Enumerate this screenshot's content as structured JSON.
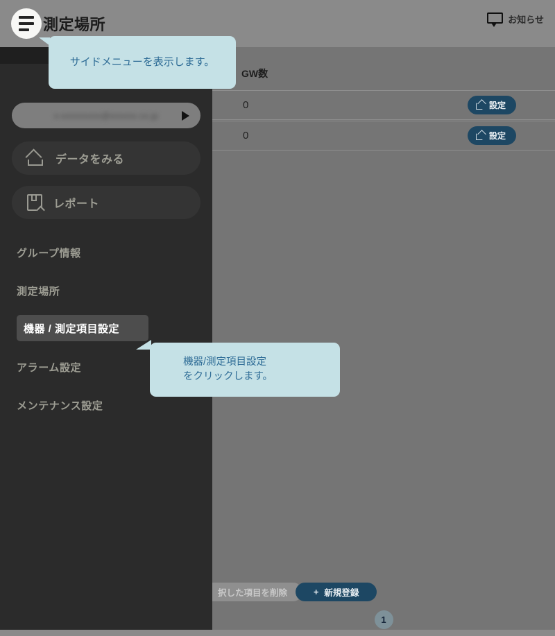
{
  "header": {
    "title": "測定場所",
    "menu_icon": "hamburger-icon",
    "notice_label": "お知らせ",
    "notice_icon": "speech-bubble-icon"
  },
  "table": {
    "column_header": "GW数",
    "rows": [
      {
        "gw_count": "0",
        "action_label": "設定"
      },
      {
        "gw_count": "0",
        "action_label": "設定"
      }
    ]
  },
  "actions": {
    "delete_label": "択した項目を削除",
    "new_label": "新規登録",
    "new_plus": "+"
  },
  "pagination": {
    "current_page": "1"
  },
  "sidebar": {
    "account": {
      "email_redacted": "s-xxxxxxxxx@xxxxxx.co.jp",
      "caret_icon": "play-triangle-icon"
    },
    "pills": [
      {
        "label": "データをみる",
        "icon": "home-icon"
      },
      {
        "label": "レポート",
        "icon": "report-icon"
      }
    ],
    "items": [
      {
        "label": "グループ情報",
        "active": false
      },
      {
        "label": "測定場所",
        "active": false
      },
      {
        "label": "機器 / 測定項目設定",
        "active": true
      },
      {
        "label": "アラーム設定",
        "active": false
      },
      {
        "label": "メンテナンス設定",
        "active": false
      }
    ]
  },
  "tooltips": [
    {
      "text": "サイドメニューを表示します。"
    },
    {
      "text": "機器/測定項目設定\nをクリックします。"
    }
  ],
  "colors": {
    "accent_dark_blue": "#1d4763",
    "tooltip_bg": "#c5e1e6",
    "tooltip_text": "#2e6c96",
    "sidebar_bg": "#2b2b2b",
    "sidebar_active": "#4d4d4d",
    "overlay_dim": "#757575"
  }
}
